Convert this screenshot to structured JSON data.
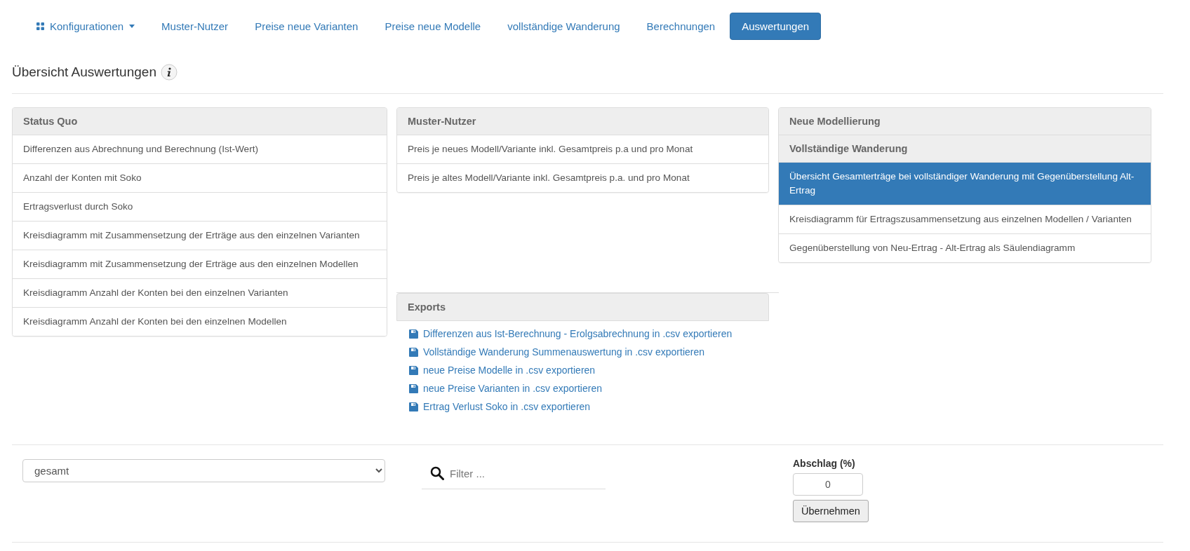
{
  "nav": {
    "dropdown": {
      "label": "Konfigurationen"
    },
    "tabs": [
      {
        "label": "Muster-Nutzer",
        "selected": false
      },
      {
        "label": "Preise neue Varianten",
        "selected": false
      },
      {
        "label": "Preise neue Modelle",
        "selected": false
      },
      {
        "label": "vollständige Wanderung",
        "selected": false
      },
      {
        "label": "Berechnungen",
        "selected": false
      },
      {
        "label": "Auswertungen",
        "selected": true
      }
    ]
  },
  "page_title": "Übersicht Auswertungen",
  "columns": [
    {
      "panels": [
        {
          "kind": "list",
          "headers": [
            "Status Quo"
          ],
          "items": [
            {
              "label": "Differenzen aus Abrechnung und Berechnung (Ist-Wert)",
              "selected": false
            },
            {
              "label": "Anzahl der Konten mit Soko",
              "selected": false
            },
            {
              "label": "Ertragsverlust durch Soko",
              "selected": false
            },
            {
              "label": "Kreisdiagramm mit Zusammensetzung der Erträge aus den einzelnen Varianten",
              "selected": false
            },
            {
              "label": "Kreisdiagramm mit Zusammensetzung der Erträge aus den einzelnen Modellen",
              "selected": false
            },
            {
              "label": "Kreisdiagramm Anzahl der Konten bei den einzelnen Varianten",
              "selected": false
            },
            {
              "label": "Kreisdiagramm Anzahl der Konten bei den einzelnen Modellen",
              "selected": false
            }
          ]
        }
      ]
    },
    {
      "panels": [
        {
          "kind": "list",
          "headers": [
            "Muster-Nutzer"
          ],
          "items": [
            {
              "label": "Preis je neues Modell/Variante inkl. Gesamtpreis p.a und pro Monat",
              "selected": false
            },
            {
              "label": "Preis je altes Modell/Variante inkl. Gesamtpreis p.a. und pro Monat",
              "selected": false
            }
          ]
        },
        {
          "kind": "links",
          "headers": [
            "Exports"
          ],
          "items": [
            {
              "label": "Differenzen aus Ist-Berechnung - Erolgsabrechnung in .csv exportieren"
            },
            {
              "label": "Vollständige Wanderung Summenauswertung in .csv exportieren"
            },
            {
              "label": "neue Preise Modelle in .csv exportieren"
            },
            {
              "label": "neue Preise Varianten in .csv exportieren"
            },
            {
              "label": "Ertrag Verlust Soko in .csv exportieren"
            }
          ]
        }
      ]
    },
    {
      "panels": [
        {
          "kind": "list",
          "headers": [
            "Neue Modellierung",
            "Vollständige Wanderung"
          ],
          "items": [
            {
              "label": "Übersicht Gesamterträge bei vollständiger Wanderung mit Gegenüberstellung Alt-Ertrag",
              "selected": true
            },
            {
              "label": "Kreisdiagramm für Ertragszusammensetzung aus einzelnen Modellen / Varianten",
              "selected": false
            },
            {
              "label": "Gegenüberstellung von Neu-Ertrag - Alt-Ertrag als Säulendiagramm",
              "selected": false
            }
          ]
        }
      ]
    }
  ],
  "controls": {
    "select": {
      "value": "gesamt"
    },
    "filter": {
      "placeholder": "Filter ..."
    },
    "discount": {
      "label": "Abschlag (%)",
      "value": "0",
      "button": "Übernehmen"
    }
  }
}
